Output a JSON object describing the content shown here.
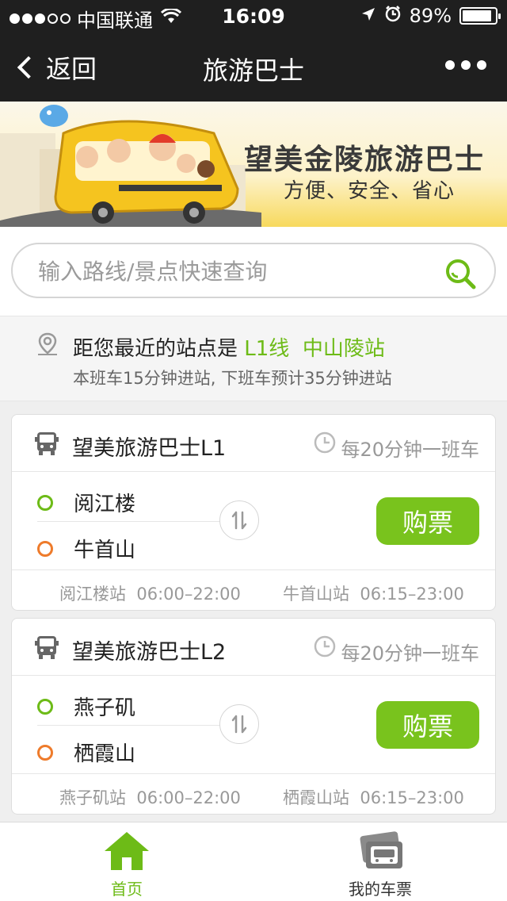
{
  "status": {
    "carrier": "中国联通",
    "time": "16:09",
    "battery": "89%",
    "battery_level": 0.89
  },
  "nav": {
    "back_label": "返回",
    "title": "旅游巴士"
  },
  "banner": {
    "title": "望美金陵旅游巴士",
    "subtitle": "方便、安全、省心"
  },
  "search": {
    "placeholder": "输入路线/景点快速查询"
  },
  "nearby": {
    "prefix": "距您最近的站点是 ",
    "line": "L1线",
    "station": "中山陵站",
    "eta": "本班车15分钟进站, 下班车预计35分钟进站"
  },
  "routes": [
    {
      "name": "望美旅游巴士L1",
      "frequency": "每20分钟一班车",
      "from": "阅江楼",
      "to": "牛首山",
      "buy_label": "购票",
      "from_schedule": "阅江楼站  06:00–22:00",
      "to_schedule": "牛首山站  06:15–23:00"
    },
    {
      "name": "望美旅游巴士L2",
      "frequency": "每20分钟一班车",
      "from": "燕子矶",
      "to": "栖霞山",
      "buy_label": "购票",
      "from_schedule": "燕子矶站  06:00–22:00",
      "to_schedule": "栖霞山站  06:15–23:00"
    }
  ],
  "tabs": {
    "home": "首页",
    "tickets": "我的车票"
  },
  "colors": {
    "accent": "#79c31d",
    "green_text": "#6dbb17",
    "orange": "#ee7b2b",
    "nav_bg": "#1f1f1f"
  }
}
